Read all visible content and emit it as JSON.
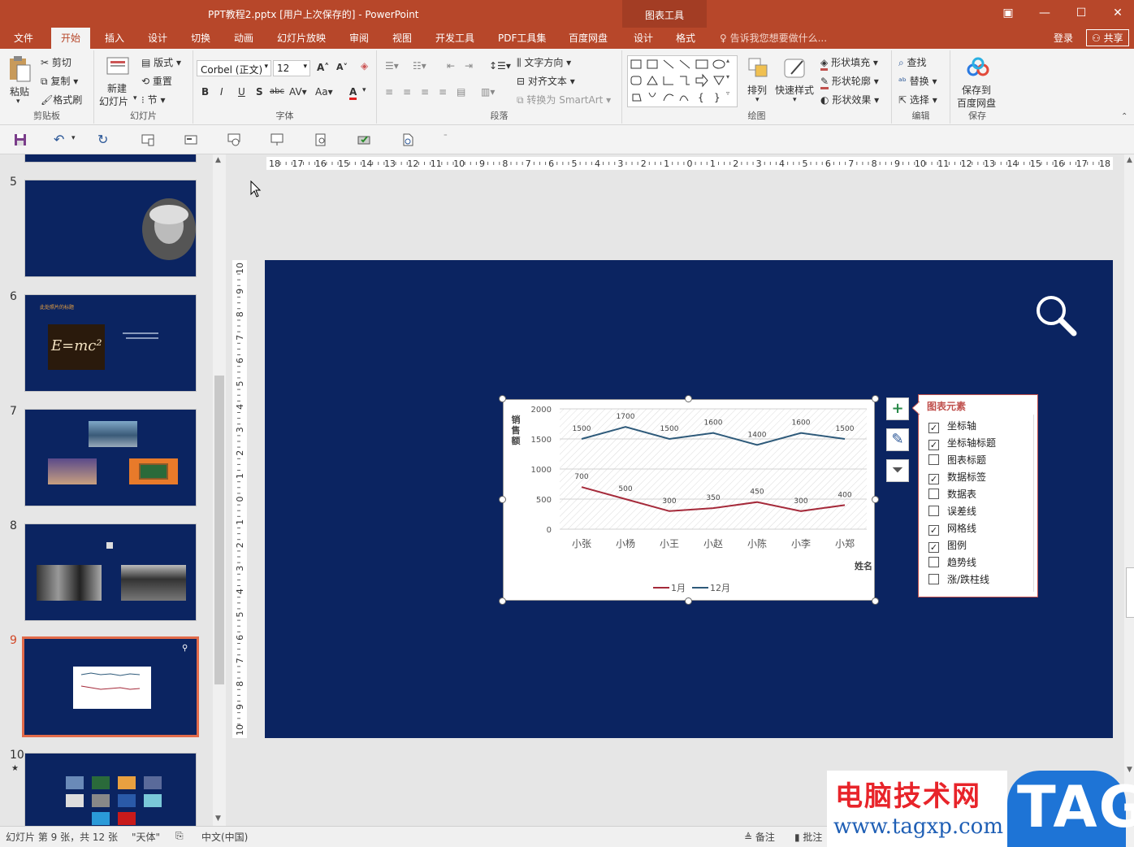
{
  "window": {
    "title": "PPT教程2.pptx [用户上次保存的] - PowerPoint",
    "context_tools": "图表工具",
    "buttons": [
      "restore-ribbon",
      "minimize",
      "maximize",
      "close"
    ]
  },
  "tabs": [
    "文件",
    "开始",
    "插入",
    "设计",
    "切换",
    "动画",
    "幻灯片放映",
    "审阅",
    "视图",
    "开发工具",
    "PDF工具集",
    "百度网盘",
    "设计",
    "格式"
  ],
  "active_tab": "开始",
  "tellme": "告诉我您想要做什么...",
  "account": {
    "login": "登录",
    "share": "共享"
  },
  "ribbon": {
    "clipboard": {
      "paste": "粘贴",
      "cut": "剪切",
      "copy": "复制",
      "format_painter": "格式刷",
      "label": "剪贴板"
    },
    "slides": {
      "new_slide_1": "新建",
      "new_slide_2": "幻灯片",
      "layout": "版式",
      "reset": "重置",
      "section": "节",
      "label": "幻灯片"
    },
    "font": {
      "font_name": "Corbel (正文)",
      "font_size": "12",
      "label": "字体",
      "bold": "B",
      "italic": "I",
      "underline": "U",
      "shadow": "S",
      "strike": "abc",
      "spacing": "AV",
      "case": "Aa",
      "color": "A"
    },
    "paragraph": {
      "text_direction": "文字方向",
      "align_text": "对齐文本",
      "smartart": "转换为 SmartArt",
      "label": "段落"
    },
    "drawing": {
      "arrange": "排列",
      "quick_styles": "快速样式",
      "shape_fill": "形状填充",
      "shape_outline": "形状轮廓",
      "shape_effects": "形状效果",
      "label": "绘图"
    },
    "editing": {
      "find": "查找",
      "replace": "替换",
      "select": "选择",
      "label": "编辑"
    },
    "save": {
      "save_to_1": "保存到",
      "save_to_2": "百度网盘",
      "label": "保存"
    }
  },
  "thumbnails": [
    {
      "num": "5"
    },
    {
      "num": "6",
      "title": "此处照片的标题",
      "formula": "E=mc²"
    },
    {
      "num": "7"
    },
    {
      "num": "8"
    },
    {
      "num": "9",
      "selected": true
    },
    {
      "num": "10",
      "star": "★"
    }
  ],
  "ruler": {
    "h_ticks": [
      "18",
      "17",
      "16",
      "15",
      "14",
      "13",
      "12",
      "11",
      "10",
      "9",
      "8",
      "7",
      "6",
      "5",
      "4",
      "3",
      "2",
      "1",
      "0",
      "1",
      "2",
      "3",
      "4",
      "5",
      "6",
      "7",
      "8",
      "9",
      "10",
      "11",
      "12",
      "13",
      "14",
      "15",
      "16",
      "17",
      "18"
    ],
    "v_ticks": [
      "10",
      "9",
      "8",
      "7",
      "6",
      "5",
      "4",
      "3",
      "2",
      "1",
      "0",
      "1",
      "2",
      "3",
      "4",
      "5",
      "6",
      "7",
      "8",
      "9",
      "10"
    ]
  },
  "chart_data": {
    "type": "line",
    "categories": [
      "小张",
      "小杨",
      "小王",
      "小赵",
      "小陈",
      "小李",
      "小郑"
    ],
    "series": [
      {
        "name": "1月",
        "values": [
          700,
          500,
          300,
          350,
          450,
          300,
          400
        ],
        "color": "#a52a3a"
      },
      {
        "name": "12月",
        "values": [
          1500,
          1700,
          1500,
          1600,
          1400,
          1600,
          1500
        ],
        "color": "#2e5a7a"
      }
    ],
    "ylabel": "销售额",
    "xlabel": "姓名",
    "ylim": [
      0,
      2000
    ],
    "yticks": [
      "2000",
      "1500",
      "1000",
      "500",
      "0"
    ],
    "grid": true,
    "legend": "bottom"
  },
  "chart_elements": {
    "title": "图表元素",
    "items": [
      {
        "label": "坐标轴",
        "checked": true
      },
      {
        "label": "坐标轴标题",
        "checked": true
      },
      {
        "label": "图表标题",
        "checked": false
      },
      {
        "label": "数据标签",
        "checked": true
      },
      {
        "label": "数据表",
        "checked": false
      },
      {
        "label": "误差线",
        "checked": false
      },
      {
        "label": "网格线",
        "checked": true
      },
      {
        "label": "图例",
        "checked": true
      },
      {
        "label": "趋势线",
        "checked": false
      },
      {
        "label": "涨/跌柱线",
        "checked": false
      }
    ]
  },
  "status": {
    "slide_info": "幻灯片 第 9 张，共 12 张",
    "theme": "\"天体\"",
    "language": "中文(中国)",
    "notes": "备注",
    "comments": "批注"
  },
  "watermark": {
    "site_cn": "电脑技术网",
    "site_url": "www.tagxp.com",
    "tag": "TAG"
  },
  "colors": {
    "accent": "#b7472a",
    "slide_bg": "#0b2461",
    "selection": "#e26b4a"
  }
}
